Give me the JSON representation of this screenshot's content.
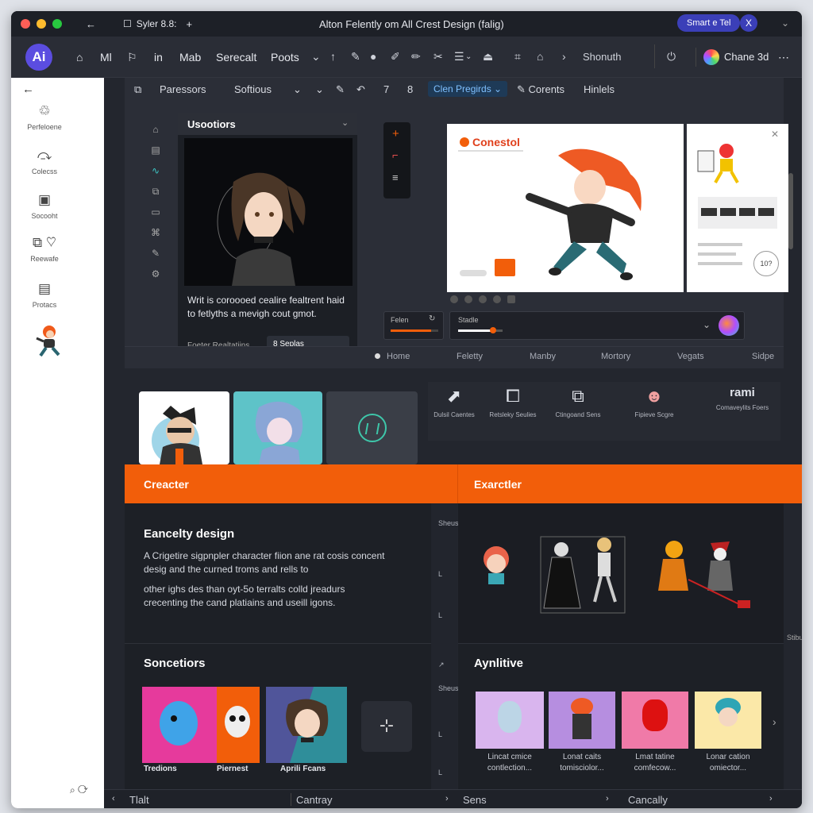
{
  "window": {
    "title": "Alton Felently om All Crest Design (falig)",
    "app_tab": "Syler 8.8:",
    "add_tab": "+",
    "back": "←",
    "share_button": "Smart e Tel",
    "close_button": "X"
  },
  "menubar": {
    "logo": "Ai",
    "items": [
      "Ml",
      "in",
      "Mab",
      "Serecalt",
      "Poots"
    ],
    "user_label": "Shonuth",
    "account_label": "Chane 3d",
    "more": "⋯"
  },
  "sidebar": {
    "back": "←",
    "items": [
      {
        "label": "Perfeloene"
      },
      {
        "label": "Colecss"
      },
      {
        "label": "Socooht"
      },
      {
        "label": "Reewafe"
      },
      {
        "label": "Protacs"
      }
    ]
  },
  "toolbar": {
    "items": [
      "Paressors",
      "Softious"
    ],
    "n7": "7",
    "n8": "8",
    "active_tab": "Clen Pregirds",
    "tab_contents": "Corents",
    "tab_hinels": "Hinlels"
  },
  "layers_panel": {
    "title": "Usootiors",
    "caption": "Writ is coroooed cealire fealtrent haid to fetlyths a mevigh cout gmot.",
    "footer_label": "Foeter Realtatiins",
    "footer_button": "8 Seplas"
  },
  "canvas": {
    "brand": "Conestol",
    "side_badge": "10?"
  },
  "sliders": {
    "left_label": "Felen",
    "right_label": "Stadle",
    "left_value": 0.85,
    "right_value": 0.8
  },
  "nav_row": [
    "Home",
    "Feletty",
    "Manby",
    "Mortory",
    "Vegats",
    "Sidpe"
  ],
  "features": [
    {
      "label": "Dulsil Caentes"
    },
    {
      "label": "Retsleky Seulies"
    },
    {
      "label": "Ctingoand Sens"
    },
    {
      "label": "Fipieve Scgre"
    },
    {
      "label": "Comaveylits Foers"
    }
  ],
  "features_logo": "rami",
  "orange_bar": {
    "left": "Creacter",
    "right": "Exarctler"
  },
  "design_section": {
    "title": "Eancelty design",
    "para1": "A Crigetire sigpnpler character fiion ane rat cosis concent desig and the curned troms and rells to",
    "para2": "other ighs des than oyt-5o terralts colld jreadurs crecenting the cand platiains and useill igons."
  },
  "sessions_section": {
    "title": "Soncetiors",
    "tiles": [
      "Tredions",
      "Piernest",
      "Aprili Fcans"
    ]
  },
  "analytics_section": {
    "title": "Aynlitive",
    "cards": [
      {
        "label": "Lincat cmice contlection..."
      },
      {
        "label": "Lonat caits tomisciolor..."
      },
      {
        "label": "Lmat tatine comfecow..."
      },
      {
        "label": "Lonar cation omiector..."
      }
    ]
  },
  "vstrip_left": [
    "Sheus",
    "L",
    "L"
  ],
  "vstrip_right": [
    "Sheus",
    "L",
    "L"
  ],
  "vstrip_edge": "Stibu",
  "bottom_bar": [
    "Tlalt",
    "Cantray",
    "Sens",
    "Cancally"
  ],
  "colors": {
    "accent_orange": "#f25e0a",
    "accent_purple": "#5b4de0",
    "bg_dark": "#23262e"
  }
}
